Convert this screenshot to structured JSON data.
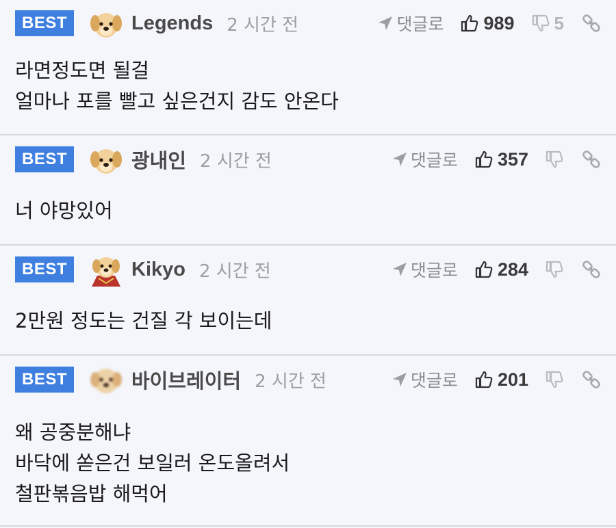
{
  "labels": {
    "best": "BEST",
    "reply": "댓글로"
  },
  "colors": {
    "best_badge": "#3f7fe0",
    "background": "#f4f6fc",
    "nick": "#4a4a4a",
    "meta": "#9b9ea4"
  },
  "icons": {
    "reply": "send-arrow-icon",
    "upvote": "thumbs-up-icon",
    "downvote": "thumbs-down-icon",
    "link": "chain-link-icon"
  },
  "comments": [
    {
      "nick": "Legends",
      "time": "2 시간 전",
      "avatar": "puppy-avatar",
      "upvotes": "989",
      "downvotes": "5",
      "lines": [
        "라면정도면 될걸",
        "얼마나 포를 빨고 싶은건지 감도 안온다"
      ]
    },
    {
      "nick": "광내인",
      "time": "2 시간 전",
      "avatar": "puppy-avatar",
      "upvotes": "357",
      "downvotes": "",
      "lines": [
        "너 야망있어"
      ]
    },
    {
      "nick": "Kikyo",
      "time": "2 시간 전",
      "avatar": "puppy-cape-avatar",
      "upvotes": "284",
      "downvotes": "",
      "lines": [
        "2만원 정도는 건질 각 보이는데"
      ]
    },
    {
      "nick": "바이브레이터",
      "time": "2 시간 전",
      "avatar": "puppy-blurred-avatar",
      "upvotes": "201",
      "downvotes": "",
      "lines": [
        "왜 공중분해냐",
        "바닥에 쏟은건 보일러 온도올려서",
        "철판볶음밥 해먹어"
      ]
    }
  ]
}
